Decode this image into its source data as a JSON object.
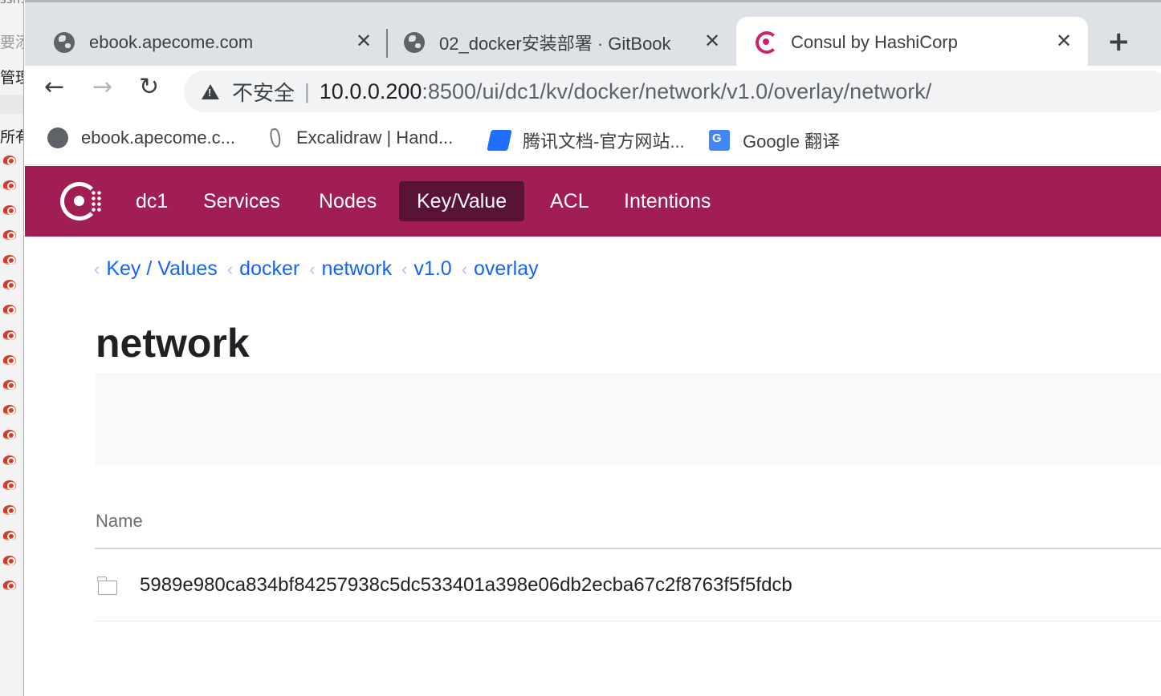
{
  "background_app": {
    "fragments": [
      "ssh://root@",
      "要添",
      "管理",
      "所有"
    ]
  },
  "browser": {
    "tabs": [
      {
        "title": "ebook.apecome.com",
        "icon": "globe-icon",
        "active": false
      },
      {
        "title": "02_docker安装部署 · GitBook",
        "icon": "globe-icon",
        "active": false
      },
      {
        "title": "Consul by HashiCorp",
        "icon": "consul-favicon-icon",
        "active": true
      }
    ],
    "close_glyph": "✕",
    "new_tab_glyph": "+",
    "toolbar": {
      "back_glyph": "←",
      "forward_glyph": "→",
      "reload_glyph": "↻"
    },
    "omnibox": {
      "security_label": "不安全",
      "separator": "|",
      "url_host": "10.0.0.200",
      "url_path": ":8500/ui/dc1/kv/docker/network/v1.0/overlay/network/"
    },
    "bookmarks": [
      {
        "label": "ebook.apecome.c...",
        "icon": "globe-icon"
      },
      {
        "label": "Excalidraw | Hand...",
        "icon": "excalidraw-icon"
      },
      {
        "label": "腾讯文档-官方网站...",
        "icon": "tencent-docs-icon"
      },
      {
        "label": "Google 翻译",
        "icon": "google-translate-icon"
      }
    ]
  },
  "consul": {
    "brand_color": "#a11e55",
    "nav": [
      {
        "label": "dc1",
        "active": false
      },
      {
        "label": "Services",
        "active": false
      },
      {
        "label": "Nodes",
        "active": false
      },
      {
        "label": "Key/Value",
        "active": true
      },
      {
        "label": "ACL",
        "active": false
      },
      {
        "label": "Intentions",
        "active": false
      }
    ],
    "breadcrumbs": [
      "Key / Values",
      "docker",
      "network",
      "v1.0",
      "overlay"
    ],
    "breadcrumb_chevron": "‹",
    "page_title": "network",
    "table": {
      "column_name": "Name",
      "rows": [
        {
          "name": "5989e980ca834bf84257938c5dc533401a398e06db2ecba67c2f8763f5f5fdcb",
          "icon": "folder-icon"
        }
      ]
    }
  }
}
